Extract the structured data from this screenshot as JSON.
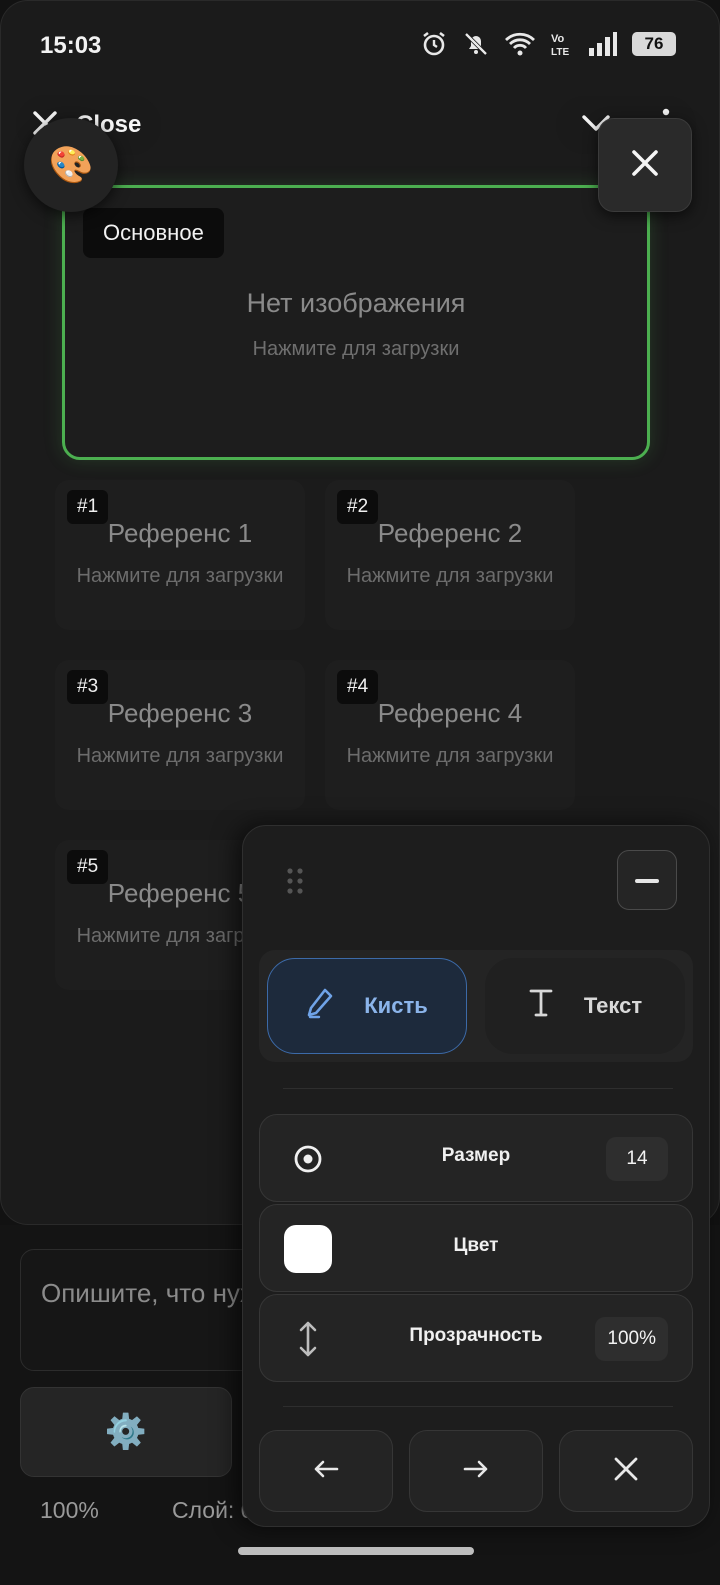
{
  "status_bar": {
    "time": "15:03",
    "battery": "76",
    "icons": [
      "alarm-icon",
      "mute-icon",
      "wifi-icon",
      "volte-icon",
      "signal-icon",
      "battery-icon"
    ]
  },
  "top_bar": {
    "close_label": "Close",
    "icons": [
      "close-icon",
      "chevron-down-icon",
      "more-vertical-icon"
    ]
  },
  "palette_button": {
    "emoji": "🎨"
  },
  "main_card": {
    "tag": "Основное",
    "title": "Нет изображения",
    "subtitle": "Нажмите для загрузки",
    "border_color": "#4caf50"
  },
  "references": [
    {
      "tag": "#1",
      "title": "Референс 1",
      "subtitle": "Нажмите для загрузки"
    },
    {
      "tag": "#2",
      "title": "Референс 2",
      "subtitle": "Нажмите для загрузки"
    },
    {
      "tag": "#3",
      "title": "Референс 3",
      "subtitle": "Нажмите для загрузки"
    },
    {
      "tag": "#4",
      "title": "Референс 4",
      "subtitle": "Нажмите для загрузки"
    },
    {
      "tag": "#5",
      "title": "Референс 5",
      "subtitle": "Нажмите для загрузки"
    }
  ],
  "prompt": {
    "placeholder": "Опишите, что нужно сгенерировать"
  },
  "settings_button": {
    "emoji": "⚙️"
  },
  "footer": {
    "zoom": "100%",
    "layer": "Слой: 0"
  },
  "tool_panel": {
    "tabs": [
      {
        "label": "Кисть",
        "icon": "brush-icon",
        "active": true
      },
      {
        "label": "Текст",
        "icon": "text-icon",
        "active": false
      }
    ],
    "size": {
      "label": "Размер",
      "value": "14",
      "icon": "target-icon"
    },
    "color": {
      "label": "Цвет",
      "value": "#ffffff"
    },
    "opacity": {
      "label": "Прозрачность",
      "value": "100%",
      "icon": "vertical-arrows-icon"
    },
    "nav": [
      "arrow-left-icon",
      "arrow-right-icon",
      "close-icon"
    ],
    "accent": "#3c6aa8"
  }
}
